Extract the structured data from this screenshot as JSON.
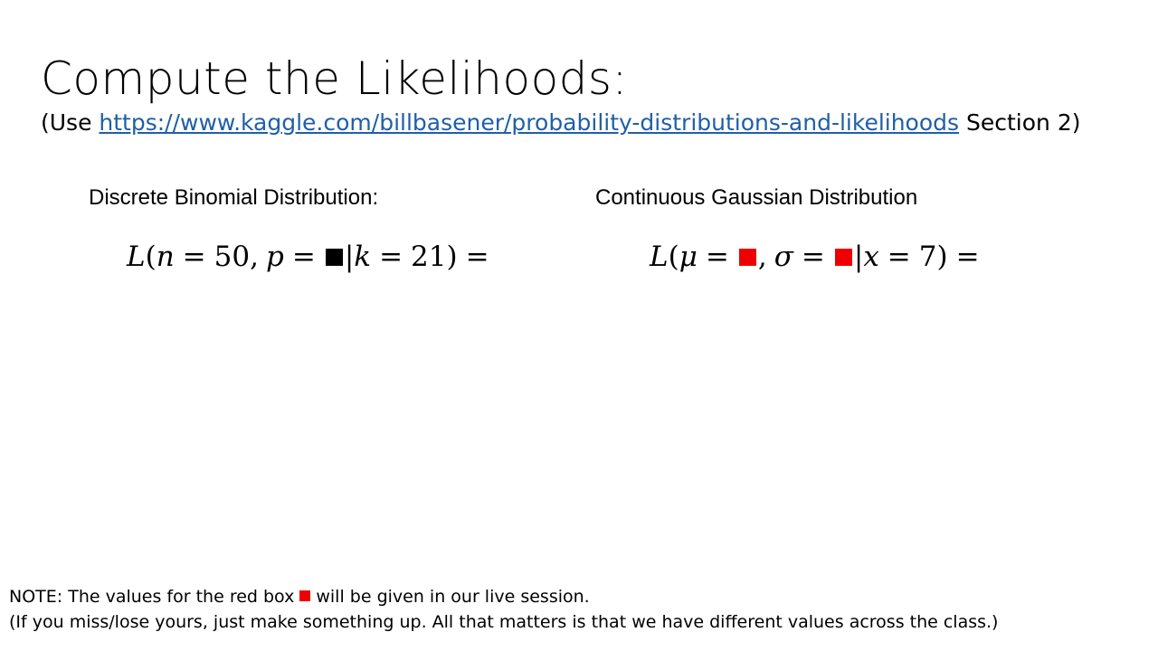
{
  "slide": {
    "title": "Compute the Likelihoods:",
    "subtitle_prefix": "(Use ",
    "subtitle_link": "https://www.kaggle.com/billbasener/probability-distributions-and-likelihoods",
    "subtitle_suffix": " Section 2)",
    "left": {
      "heading": "Discrete Binomial Distribution:",
      "eq_L": "L",
      "eq_open": "(",
      "var1": "n",
      "val1": "50",
      "var2": "p",
      "var3": "k",
      "val3": "21",
      "eq_close": ")",
      "eq": "=",
      "comma": ",",
      "bar": "|"
    },
    "right": {
      "heading": "Continuous Gaussian Distribution",
      "eq_L": "L",
      "eq_open": "(",
      "var1": "μ",
      "var2": "σ",
      "var3": "x",
      "val3": "7",
      "eq_close": ")",
      "eq": "=",
      "comma": ",",
      "bar": "|"
    },
    "note_line1_prefix": "NOTE:  The values for the red box",
    "note_line1_suffix": "will be given in our live session.",
    "note_line2": "(If you miss/lose yours, just make something up.  All that matters is that we have different values across the class.)"
  },
  "colors": {
    "red_box": "#ee0000",
    "black_box": "#000000",
    "link": "#1f5fa8"
  }
}
